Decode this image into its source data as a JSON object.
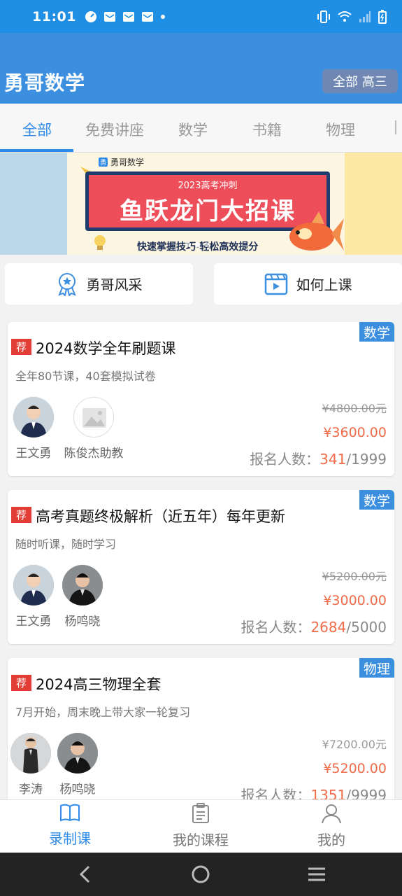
{
  "status_bar": {
    "time": "11:01"
  },
  "app_bar": {
    "title": "勇哥数学",
    "filter_label": "全部 高三"
  },
  "tabs": [
    {
      "label": "全部"
    },
    {
      "label": "免费讲座"
    },
    {
      "label": "数学"
    },
    {
      "label": "书籍"
    },
    {
      "label": "物理"
    }
  ],
  "banner": {
    "brand": "勇哥数学",
    "subtitle": "2023高考冲刺",
    "headline": "鱼跃龙门大招课",
    "slogan": "快速掌握技巧·轻松高效提分"
  },
  "quick_links": [
    {
      "label": "勇哥风采"
    },
    {
      "label": "如何上课"
    }
  ],
  "enroll_label": "报名人数：",
  "courses": [
    {
      "recommend": "荐",
      "subject": "数学",
      "title": "2024数学全年刷题课",
      "desc": "全年80节课，40套模拟试卷",
      "original_price": "¥4800.00元",
      "price": "¥3600.00",
      "enrolled": "341",
      "capacity": "/1999",
      "teachers": [
        {
          "name": "王文勇"
        },
        {
          "name": "陈俊杰助教"
        }
      ]
    },
    {
      "recommend": "荐",
      "subject": "数学",
      "title": "高考真题终极解析（近五年）每年更新",
      "desc": "随时听课，随时学习",
      "original_price": "¥5200.00元",
      "price": "¥3000.00",
      "enrolled": "2684",
      "capacity": "/5000",
      "teachers": [
        {
          "name": "王文勇"
        },
        {
          "name": "杨鸣晓"
        }
      ]
    },
    {
      "recommend": "荐",
      "subject": "物理",
      "title": "2024高三物理全套",
      "desc": "7月开始，周末晚上带大家一轮复习",
      "original_price": "¥7200.00元",
      "price": "¥5200.00",
      "enrolled": "1351",
      "capacity": "/9999",
      "teachers": [
        {
          "name": "李涛"
        },
        {
          "name": "杨鸣晓"
        }
      ]
    }
  ],
  "bottom_nav": [
    {
      "label": "录制课"
    },
    {
      "label": "我的课程"
    },
    {
      "label": "我的"
    }
  ],
  "colors": {
    "primary": "#3c8fdf",
    "accent": "#ef6b49",
    "tag_red": "#e33e36"
  }
}
